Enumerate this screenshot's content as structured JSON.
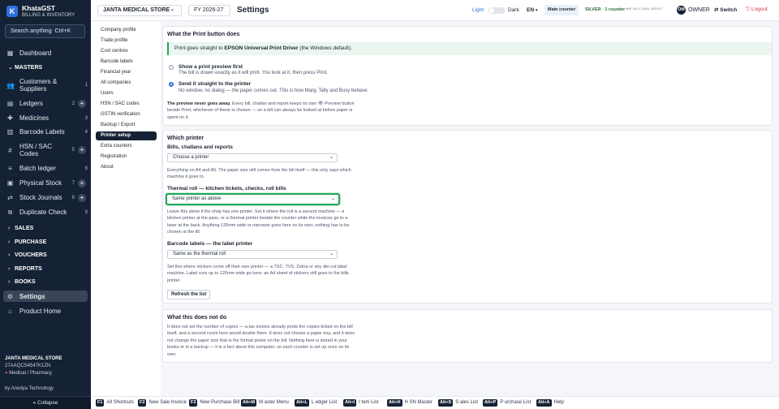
{
  "brand": {
    "name": "KhataGST",
    "tagline": "BILLING & INVENTORY",
    "logo_letter": "K"
  },
  "search": {
    "label": "Search anything",
    "shortcut": "Ctrl+K"
  },
  "sidebar": {
    "items": [
      {
        "label": "Dashboard",
        "icon": "grid-icon"
      },
      {
        "label": "Customers & Suppliers",
        "count": "1"
      },
      {
        "label": "Ledgers",
        "count": "2"
      },
      {
        "label": "Medicines",
        "count": "3"
      },
      {
        "label": "Barcode Labels",
        "count": "4"
      },
      {
        "label": "HSN / SAC Codes",
        "count": "5"
      },
      {
        "label": "Batch ledger",
        "count": "6"
      },
      {
        "label": "Physical Stock",
        "count": "7"
      },
      {
        "label": "Stock Journals",
        "count": "8"
      },
      {
        "label": "Duplicate Check",
        "count": "9"
      },
      {
        "label": "Settings"
      },
      {
        "label": "Product Home"
      }
    ],
    "sections": [
      "MASTERS",
      "SALES",
      "PURCHASE",
      "VOUCHERS",
      "REPORTS",
      "BOOKS"
    ],
    "footer": {
      "company": "JANTA MEDICAL STORE",
      "gstin": "27AAQCS4547K1ZN",
      "category": "Medical / Pharmacy",
      "by": "by Anedya Technology"
    },
    "collapse": "« Collapse"
  },
  "topbar": {
    "company": "JANTA MEDICAL STORE",
    "fy": "FY 2026-27",
    "title": "Settings",
    "light": "Light",
    "dark": "Dark",
    "lang": "EN",
    "counter": "Main counter",
    "plan": "SILVER · 1 counter",
    "plan_code": "AND-SLV-2026-AEF917",
    "avatar": "OW",
    "role": "OWNER",
    "switch": "Switch",
    "logout": "Logout"
  },
  "settings_nav": [
    "Company profile",
    "Trade profile",
    "Cost centres",
    "Barcode labels",
    "Financial year",
    "All companies",
    "Users",
    "HSN / SAC codes",
    "GSTIN verification",
    "Backup / Export",
    "Printer setup",
    "Extra counters",
    "Registration",
    "About"
  ],
  "print_button": {
    "heading": "What the Print button does",
    "banner_prefix": "Print goes straight to ",
    "banner_printer": "EPSON Universal Print Driver",
    "banner_suffix": " (the Windows default).",
    "opt1_title": "Show a print preview first",
    "opt1_desc": "The bill is drawn exactly as it will print. You look at it, then press Print.",
    "opt2_title": "Send it straight to the printer",
    "opt2_desc": "No window, no dialog — the paper comes out. This is how Marg, Tally and Busy behave.",
    "note_bold": "The preview never goes away.",
    "note_line1": " Every bill, challan and report keeps its own 👁 Preview button",
    "note_line2": "beside Print, whichever of these is chosen — so a bill can always be looked at before paper is",
    "note_line3": "spent on it."
  },
  "which_printer": {
    "heading": "Which printer",
    "bills_label": "Bills, challans and reports",
    "bills_value": "Choose a printer",
    "bills_help1": "Everything on A4 and A5. The paper size still comes from the bill itself — this only says which",
    "bills_help2": "machine it goes to.",
    "thermal_label": "Thermal roll — kitchen tickets, checks, roll bills",
    "thermal_value": "Same printer as above",
    "thermal_help1": "Leave this alone if the shop has one printer. Set it where the roll is a second machine — a",
    "thermal_help2": "kitchen printer at the pass, or a thermal printer beside the counter while the invoices go to a",
    "thermal_help3": "laser at the back. Anything 120mm wide or narrower goes here on its own; nothing has to be",
    "thermal_help4": "chosen at the till.",
    "barcode_label": "Barcode labels — the label printer",
    "barcode_value": "Same as the thermal roll",
    "barcode_help1": "Set this where stickers come off their own printer — a TSC, TVS, Zebra or any die-cut label",
    "barcode_help2": "machine. Label runs up to 120mm wide go here; an A4 sheet of stickers still goes to the bills",
    "barcode_help3": "printer.",
    "refresh": "Refresh the list"
  },
  "not_do": {
    "heading": "What this does not do",
    "l1": "It does not set the number of copies — a tax invoice already prints the copies ticked on the bill",
    "l2": "itself, and a second count here would double them. It does not choose a paper tray, and it does",
    "l3": "not change the paper size that is the format picker on the bill. Nothing here is stored in your",
    "l4": "books or in a backup — it is a fact about this computer, so each counter is set up once on its",
    "l5": "own."
  },
  "shortcuts": [
    {
      "key": "F1",
      "label": "All Shortcuts"
    },
    {
      "key": "F2",
      "label": "New Sale Invoice"
    },
    {
      "key": "F3",
      "label": "New Purchase Bill"
    },
    {
      "key": "Alt+M",
      "label": "M aster Menu"
    },
    {
      "key": "Alt+L",
      "label": "L edger List"
    },
    {
      "key": "Alt+I",
      "label": "I tem List"
    },
    {
      "key": "Alt+H",
      "label": "H SN Master"
    },
    {
      "key": "Alt+S",
      "label": "S ales List"
    },
    {
      "key": "Alt+P",
      "label": "P urchase List"
    },
    {
      "key": "Alt+A",
      "label": "Help"
    }
  ],
  "colors": {
    "sidebar": "#152235",
    "accent": "#2f6fe0",
    "focus": "#22a55a",
    "banner": "#eaf6ef"
  }
}
